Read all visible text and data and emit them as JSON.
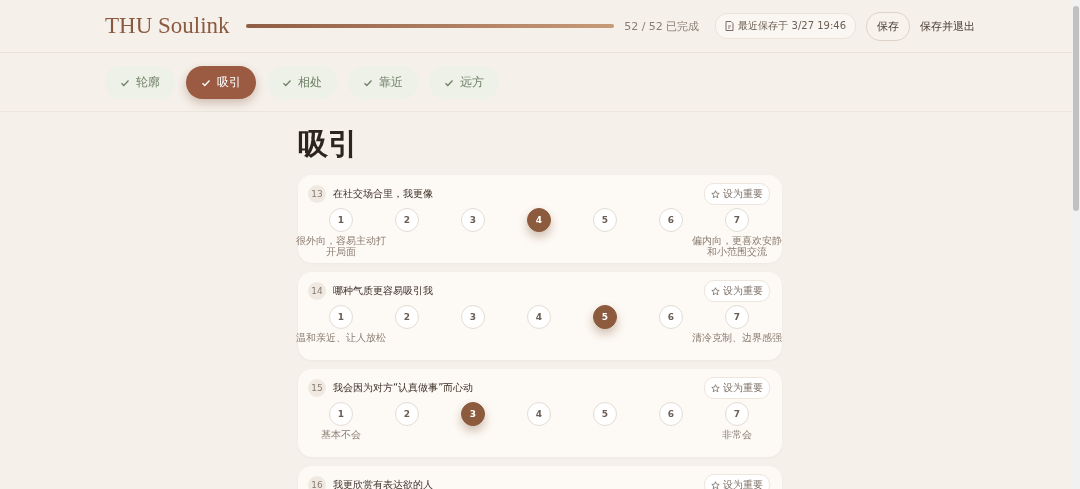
{
  "header": {
    "brand": "THU Soulink",
    "progress": {
      "level": 1,
      "reading": "52 / 52 已完成"
    },
    "saved": "最近保存于 3/27 19:46",
    "buttons": [
      {
        "label": "保存",
        "kind": "outlined"
      },
      {
        "label": "保存并退出",
        "kind": "plain"
      }
    ]
  },
  "tabs": [
    {
      "label": "轮廓",
      "done": true,
      "selected": false
    },
    {
      "label": "吸引",
      "done": true,
      "selected": true
    },
    {
      "label": "相处",
      "done": true,
      "selected": false
    },
    {
      "label": "靠近",
      "done": true,
      "selected": false
    },
    {
      "label": "远方",
      "done": true,
      "selected": false
    }
  ],
  "section_title": "吸引",
  "questions": [
    {
      "number": "13",
      "text": "在社交场合里，我更像",
      "important_label": "设为重要",
      "options": [
        {
          "label": "1",
          "selected": false
        },
        {
          "label": "2",
          "selected": false
        },
        {
          "label": "3",
          "selected": false
        },
        {
          "label": "4",
          "selected": true
        },
        {
          "label": "5",
          "selected": false
        },
        {
          "label": "6",
          "selected": false
        },
        {
          "label": "7",
          "selected": false
        }
      ],
      "low_label": "很外向，容易主动打开局面",
      "high_label": "偏内向，更喜欢安静和小范围交流"
    },
    {
      "number": "14",
      "text": "哪种气质更容易吸引我",
      "important_label": "设为重要",
      "options": [
        {
          "label": "1",
          "selected": false
        },
        {
          "label": "2",
          "selected": false
        },
        {
          "label": "3",
          "selected": false
        },
        {
          "label": "4",
          "selected": false
        },
        {
          "label": "5",
          "selected": true
        },
        {
          "label": "6",
          "selected": false
        },
        {
          "label": "7",
          "selected": false
        }
      ],
      "low_label": "温和亲近、让人放松",
      "high_label": "清冷克制、边界感强"
    },
    {
      "number": "15",
      "text": "我会因为对方“认真做事”而心动",
      "important_label": "设为重要",
      "options": [
        {
          "label": "1",
          "selected": false
        },
        {
          "label": "2",
          "selected": false
        },
        {
          "label": "3",
          "selected": true
        },
        {
          "label": "4",
          "selected": false
        },
        {
          "label": "5",
          "selected": false
        },
        {
          "label": "6",
          "selected": false
        },
        {
          "label": "7",
          "selected": false
        }
      ],
      "low_label": "基本不会",
      "high_label": "非常会"
    },
    {
      "number": "16",
      "text": "我更欣赏有表达欲的人",
      "important_label": "设为重要"
    }
  ]
}
